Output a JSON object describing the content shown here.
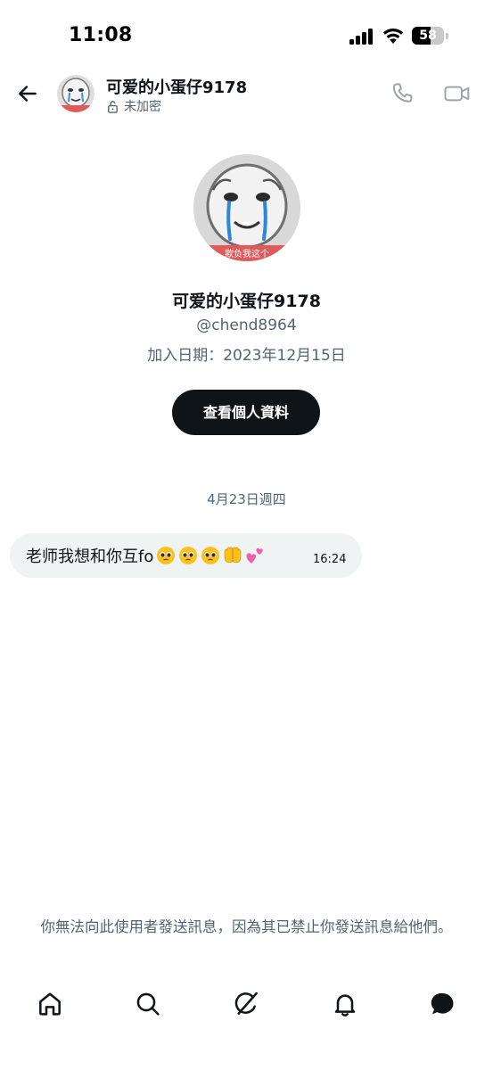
{
  "status_bar": {
    "time": "11:08",
    "battery": "58",
    "battery_level": 0.58
  },
  "header": {
    "title": "可爱的小蛋仔9178",
    "subtitle": "未加密",
    "icons": [
      "back-arrow-icon",
      "lock-open-icon",
      "phone-icon",
      "video-icon"
    ]
  },
  "profile": {
    "name": "可爱的小蛋仔9178",
    "handle": "@chend8964",
    "joined": "加入日期：2023年12月15日",
    "view_profile_label": "查看個人資料",
    "avatar_caption": "欺负我这个"
  },
  "conversation": {
    "date_separator": "4月23日週四",
    "messages": [
      {
        "text": "老师我想和你互fo",
        "emojis": [
          "pleading-face",
          "pleading-face",
          "pleading-face",
          "palms-up-together",
          "two-hearts"
        ],
        "time": "16:24"
      }
    ]
  },
  "notice": {
    "blocked": "你無法向此使用者發送訊息，因為其已禁止你發送訊息給他們。"
  },
  "nav": {
    "items": [
      "home-icon",
      "search-icon",
      "grok-icon",
      "notifications-icon",
      "messages-icon"
    ]
  },
  "colors": {
    "primary_text": "#0f1419",
    "secondary_text": "#536471",
    "bubble_bg": "#eff3f4",
    "button_bg": "#0f1419"
  }
}
